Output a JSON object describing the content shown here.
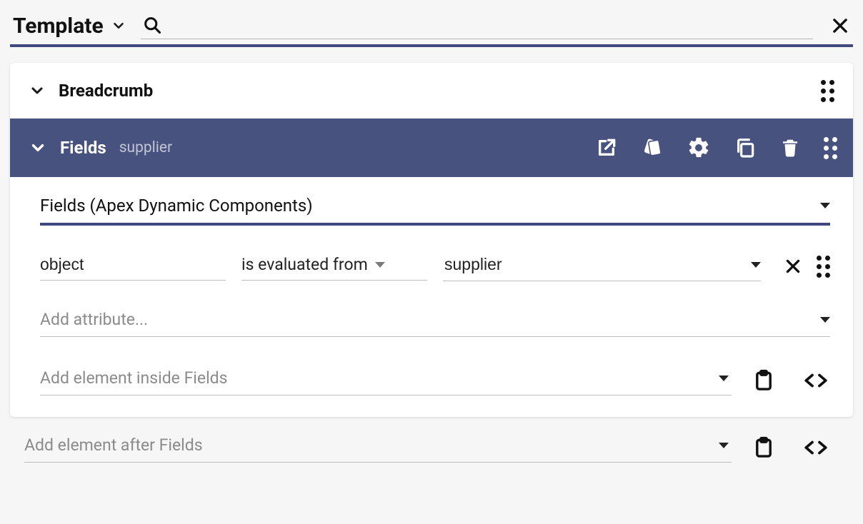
{
  "colors": {
    "accent": "#3f497d",
    "selected_bg": "#48527e"
  },
  "header": {
    "title": "Template",
    "search_placeholder": ""
  },
  "sections": {
    "breadcrumb": {
      "title": "Breadcrumb"
    },
    "fields": {
      "title": "Fields",
      "subtitle": "supplier",
      "type_label": "Fields (Apex Dynamic Components)",
      "attribute": {
        "name": "object",
        "mode": "is evaluated from",
        "value": "supplier"
      },
      "add_attribute_placeholder": "Add attribute...",
      "add_inside_placeholder": "Add element inside Fields"
    }
  },
  "after": {
    "add_after_placeholder": "Add element after Fields"
  }
}
